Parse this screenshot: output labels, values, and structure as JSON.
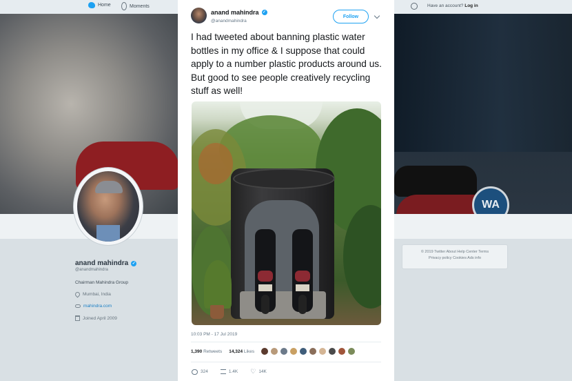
{
  "topbar": {
    "home_label": "Home",
    "moments_label": "Moments",
    "login_prompt": "Have an account?",
    "login_label": "Log in"
  },
  "banner": {
    "brand_text": "WA"
  },
  "profile": {
    "name": "anand mahindra",
    "handle": "@anandmahindra",
    "bio": "Chairman Mahindra Group",
    "location": "Mumbai, India",
    "website": "mahindra.com",
    "joined": "Joined April 2009"
  },
  "footer": {
    "row1": "© 2019 Twitter   About   Help Center   Terms",
    "row2": "Privacy policy   Cookies   Ads info"
  },
  "tweet": {
    "author_name": "anand mahindra",
    "author_handle": "@anandmahindra",
    "follow_label": "Follow",
    "text": "I had tweeted about banning plastic water bottles in my office & I suppose that could apply to a number plastic products around us. But good to see people creatively recycling stuff as well!",
    "timestamp": "10:03 PM - 17 Jul 2019",
    "retweets_count": "1,390",
    "retweets_label": "Retweets",
    "likes_count": "14,324",
    "likes_label": "Likes",
    "reply_count": "324",
    "retweet_action_count": "1.4K",
    "like_action_count": "14K"
  },
  "likers_colors": [
    "#5b3b2e",
    "#b89a7a",
    "#6c7a8a",
    "#c9a063",
    "#3f5d7a",
    "#8a6e5a",
    "#d4b595",
    "#4a4a4a",
    "#a0553a",
    "#7b8b5a"
  ],
  "colors": {
    "accent": "#1da1f2",
    "text_primary": "#14171a",
    "text_secondary": "#657786"
  }
}
